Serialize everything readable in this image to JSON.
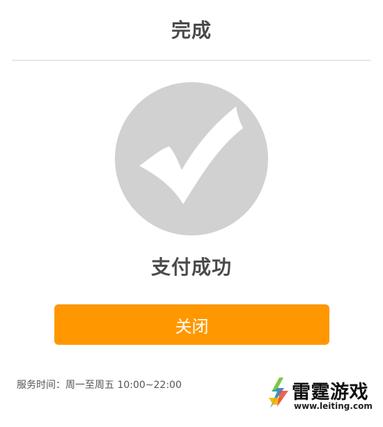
{
  "header": {
    "title": "完成"
  },
  "main": {
    "status_icon": "checkmark-circle-icon",
    "status_text": "支付成功",
    "close_label": "关闭",
    "service_hours": "服务时间：周一至周五 10:00~22:00"
  },
  "watermark": {
    "name": "雷霆游戏",
    "url": "www.leiting.com",
    "logo_icon": "lightning-icon"
  },
  "colors": {
    "accent": "#ff9800",
    "success_circle": "#d1d1d1",
    "divider": "#d6d6d6",
    "text": "#4a4a4a"
  }
}
